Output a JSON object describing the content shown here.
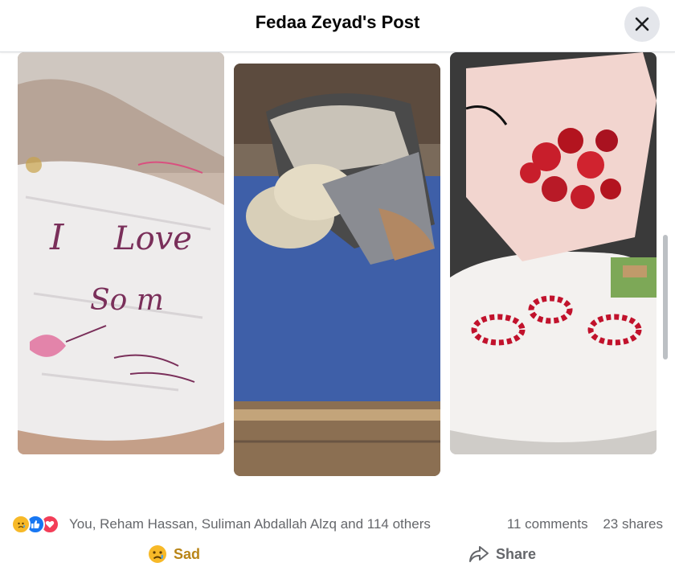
{
  "header": {
    "title": "Fedaa Zeyad's Post"
  },
  "photos": [
    {
      "name": "handwritten-note-photo"
    },
    {
      "name": "hospital-bed-photo"
    },
    {
      "name": "rose-bouquet-photo"
    }
  ],
  "reactions": {
    "icons": [
      "sad-reaction-icon",
      "like-reaction-icon",
      "love-reaction-icon"
    ],
    "names": "You, Reham Hassan, Suliman Abdallah Alzq and 114 others",
    "comments": "11 comments",
    "shares": "23 shares"
  },
  "actions": {
    "sad_label": "Sad",
    "share_label": "Share"
  },
  "colors": {
    "sad": "#b98517",
    "like": "#1877f2",
    "love": "#f33e58",
    "secondary_text": "#65676b"
  }
}
